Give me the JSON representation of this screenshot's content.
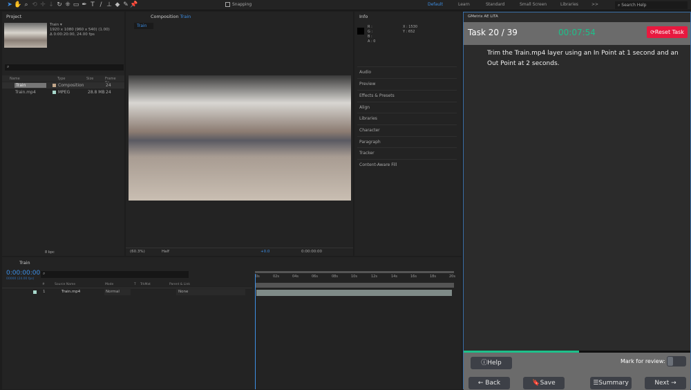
{
  "toolbar": {
    "snapping": "Snapping",
    "workspaces": [
      "Default",
      "Learn",
      "Standard",
      "Small Screen",
      "Libraries"
    ],
    "more": ">>",
    "search_placeholder": "Search Help"
  },
  "project": {
    "title": "Project",
    "comp_name": "Train ▾",
    "comp_info1": "1920 x 1080  (960 x 540) (1.00)",
    "comp_info2": "Δ 0:00:20:00, 24.00 fps",
    "columns": [
      "Name",
      "Type",
      "Size",
      "Frame Ra..."
    ],
    "items": [
      {
        "name": "Train",
        "type": "Composition",
        "size": "",
        "fps": "24"
      },
      {
        "name": "Train.mp4",
        "type": "MPEG",
        "size": "28.8 MB",
        "fps": "24"
      }
    ],
    "bpc": "8 bpc"
  },
  "composition": {
    "title": "Composition",
    "comp": "Train",
    "tab": "Train",
    "zoom": "(60.3%)",
    "resolution": "Half",
    "exposure": "+0.0",
    "timecode": "0:00:00:00"
  },
  "info": {
    "title": "Info",
    "r": "R :",
    "g": "G :",
    "b": "B :",
    "a": "A :  0",
    "x": "X : 1530",
    "y": "Y : 652",
    "panels": [
      "Audio",
      "Preview",
      "Effects & Presets",
      "Align",
      "Libraries",
      "Character",
      "Paragraph",
      "Tracker",
      "Content-Aware Fill"
    ]
  },
  "timeline": {
    "tab": "Train",
    "time": "0:00:00:00",
    "frames": "00000 (24.00 fps)",
    "columns": [
      "#",
      "Source Name",
      "Mode",
      "T",
      "TrkMat",
      "Parent & Link"
    ],
    "layer": {
      "num": "1",
      "name": "Train.mp4",
      "mode": "Normal",
      "parent": "None"
    },
    "ticks": [
      "0s",
      "02s",
      "04s",
      "06s",
      "08s",
      "10s",
      "12s",
      "14s",
      "16s",
      "18s",
      "20s"
    ]
  },
  "gmetrix": {
    "panel_title": "GMetrix AE LITA",
    "task": "Task 20 / 39",
    "timer": "00:07:54",
    "reset": "Reset Task",
    "instruction": "Trim the Train.mp4 layer using an In Point at 1 second and an Out Point at 2 seconds.",
    "progress": 0.51,
    "help": "Help",
    "mark_review": "Mark for review:",
    "back": "Back",
    "save": "Save",
    "summary": "Summary",
    "next": "Next",
    "accent": "#1dc08a",
    "reset_color": "#e8193f"
  }
}
